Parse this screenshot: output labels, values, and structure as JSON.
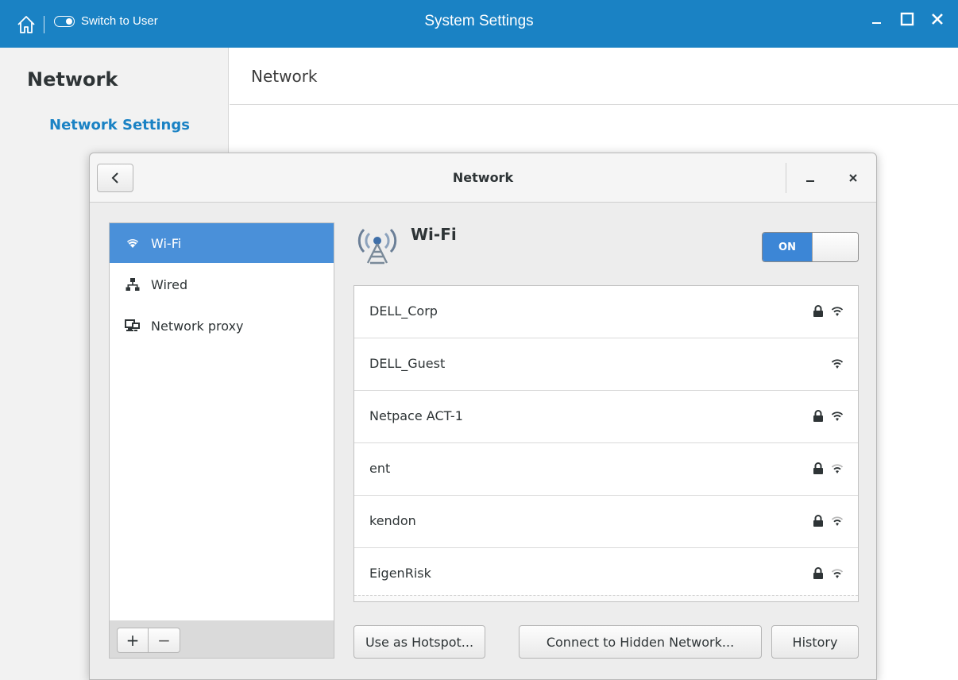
{
  "titlebar": {
    "switch_label": "Switch to User",
    "title": "System Settings"
  },
  "settings_sidebar": {
    "heading": "Network",
    "link": "Network Settings"
  },
  "main": {
    "title": "Network"
  },
  "dialog": {
    "title": "Network",
    "list_items": [
      {
        "label": "Wi-Fi",
        "icon": "wifi-icon",
        "selected": true
      },
      {
        "label": "Wired",
        "icon": "wired-network-icon",
        "selected": false
      },
      {
        "label": "Network proxy",
        "icon": "network-proxy-icon",
        "selected": false
      }
    ],
    "footer_add": "+",
    "footer_remove": "−",
    "wifi_heading": "Wi-Fi",
    "wifi_switch_label": "ON",
    "networks": [
      {
        "name": "DELL_Corp",
        "secured": true,
        "signal": "strong"
      },
      {
        "name": "DELL_Guest",
        "secured": false,
        "signal": "strong"
      },
      {
        "name": "Netpace ACT-1",
        "secured": true,
        "signal": "strong"
      },
      {
        "name": "ent",
        "secured": true,
        "signal": "weak"
      },
      {
        "name": "kendon",
        "secured": true,
        "signal": "weak"
      },
      {
        "name": "EigenRisk",
        "secured": true,
        "signal": "weak"
      }
    ],
    "buttons": {
      "hotspot": "Use as Hotspot...",
      "hidden": "Connect to Hidden Network...",
      "history": "History"
    }
  },
  "colors": {
    "titlebar": "#1a82c4",
    "accent_link": "#1a82c4",
    "selection": "#4a90d9",
    "switch_on": "#3c86d6"
  }
}
